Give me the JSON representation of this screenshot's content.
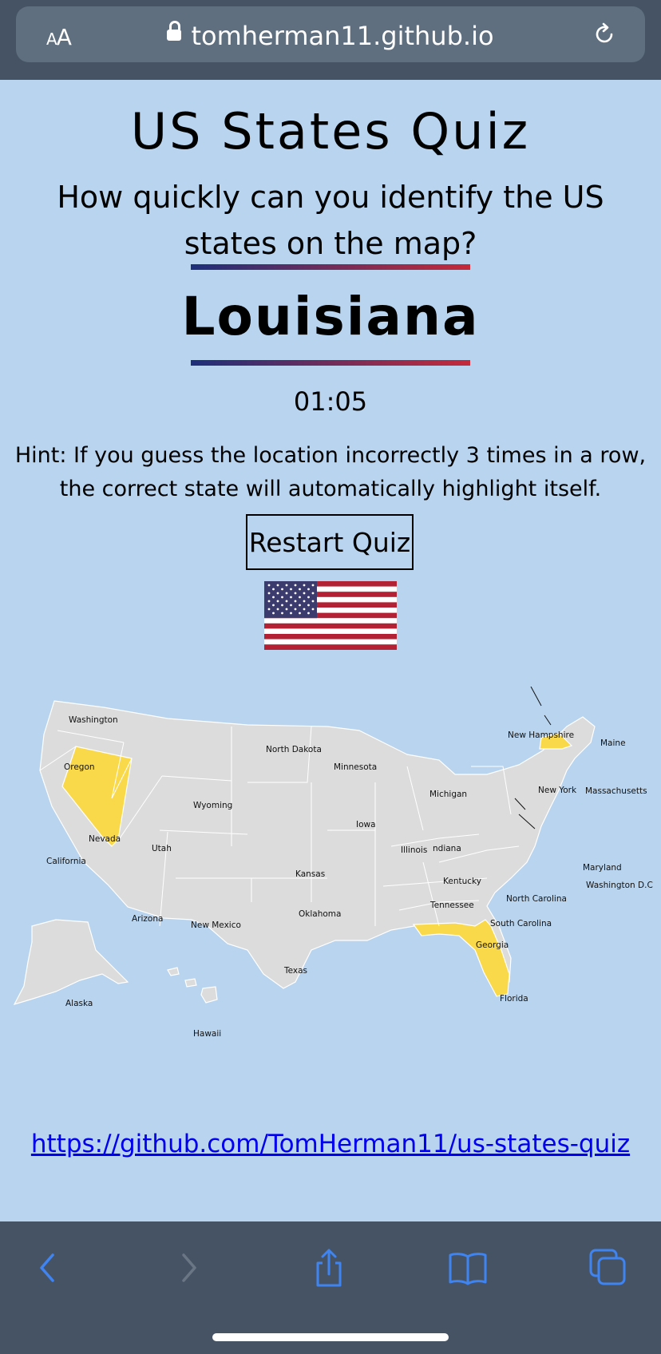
{
  "browser": {
    "text_size_label": "AA",
    "url": "tomherman11.github.io"
  },
  "page": {
    "title": "US States Quiz",
    "subtitle": "How quickly can you identify the US states on the map?",
    "current_state": "Louisiana",
    "timer": "01:05",
    "hint": "Hint: If you guess the location incorrectly 3 times in a row, the correct state will automatically highlight itself.",
    "restart_label": "Restart Quiz",
    "repo_link": "https://github.com/TomHerman11/us-states-quiz"
  },
  "map": {
    "highlight_color": "#f9d84a",
    "state_color": "#dcdcdc",
    "highlighted_states": [
      "Nevada",
      "Massachusetts",
      "Florida"
    ],
    "labels": {
      "washington": "Washington",
      "oregon": "Oregon",
      "california": "California",
      "nevada": "Nevada",
      "utah": "Utah",
      "arizona": "Arizona",
      "wyoming": "Wyoming",
      "north_dakota": "North Dakota",
      "minnesota": "Minnesota",
      "iowa": "Iowa",
      "kansas": "Kansas",
      "oklahoma": "Oklahoma",
      "new_mexico": "New Mexico",
      "texas": "Texas",
      "illinois": "Illinois",
      "indiana": "ndiana",
      "michigan": "Michigan",
      "kentucky": "Kentucky",
      "tennessee": "Tennessee",
      "georgia": "Georgia",
      "florida": "Florida",
      "south_carolina": "South Carolina",
      "north_carolina": "North Carolina",
      "maryland": "Maryland",
      "washington_dc": "Washington D.C",
      "new_york": "New York",
      "massachusetts": "Massachusetts",
      "new_hampshire": "New Hampshire",
      "maine": "Maine",
      "alaska": "Alaska",
      "hawaii": "Hawaii"
    }
  },
  "toolbar": {
    "icons": [
      "back-icon",
      "forward-icon",
      "share-icon",
      "bookmarks-icon",
      "tabs-icon"
    ]
  }
}
